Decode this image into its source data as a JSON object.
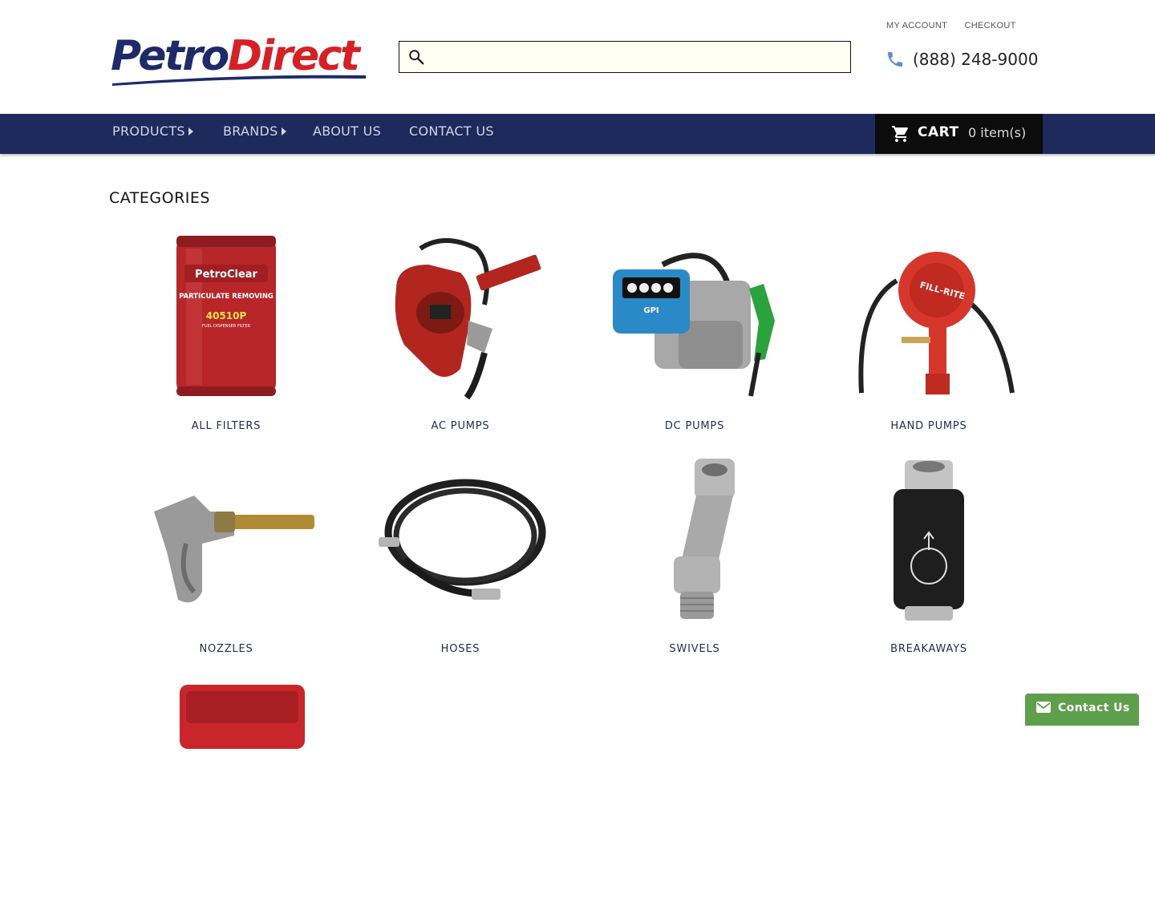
{
  "brand": {
    "logo_part1": "Petro",
    "logo_part2": "Direct",
    "primary_color": "#1f2a5c",
    "accent_color": "#d71f26"
  },
  "search": {
    "placeholder": "",
    "value": "",
    "icon": "search-icon"
  },
  "top_links": {
    "my_account": "MY ACCOUNT",
    "checkout": "CHECKOUT"
  },
  "phone": {
    "icon": "phone-icon",
    "number": "(888) 248-9000"
  },
  "nav": {
    "items": [
      {
        "label": "PRODUCTS",
        "has_submenu": true
      },
      {
        "label": "BRANDS",
        "has_submenu": true
      },
      {
        "label": "ABOUT US",
        "has_submenu": false
      },
      {
        "label": "CONTACT US",
        "has_submenu": false
      }
    ]
  },
  "cart": {
    "icon": "cart-icon",
    "label": "CART",
    "count_text": "0 item(s)"
  },
  "categories": {
    "title": "CATEGORIES",
    "items": [
      {
        "label": "ALL FILTERS",
        "icon": "filter-canister-image"
      },
      {
        "label": "AC PUMPS",
        "icon": "ac-pump-image"
      },
      {
        "label": "DC PUMPS",
        "icon": "dc-pump-image"
      },
      {
        "label": "HAND PUMPS",
        "icon": "hand-pump-image"
      },
      {
        "label": "NOZZLES",
        "icon": "nozzle-image"
      },
      {
        "label": "HOSES",
        "icon": "hose-image"
      },
      {
        "label": "SWIVELS",
        "icon": "swivel-image"
      },
      {
        "label": "BREAKAWAYS",
        "icon": "breakaway-image"
      }
    ]
  },
  "contact_widget": {
    "icon": "envelope-icon",
    "label": "Contact Us",
    "color": "#5d9f4b"
  }
}
